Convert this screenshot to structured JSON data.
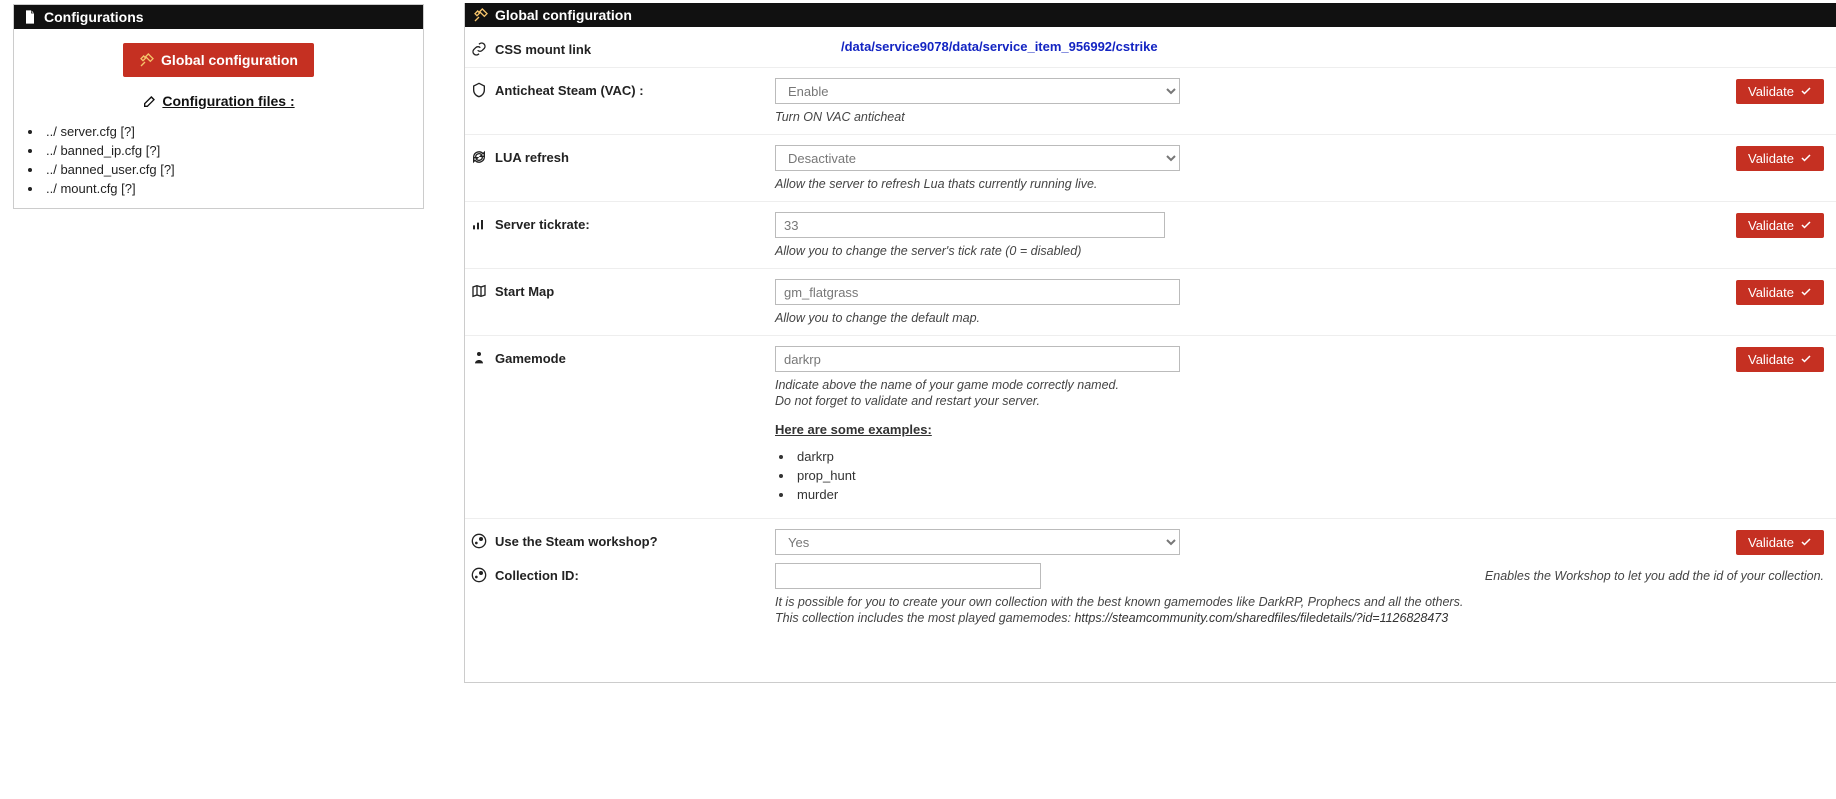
{
  "left": {
    "header": "Configurations",
    "global_btn": "Global configuration",
    "files_label": " Configuration files :",
    "files": [
      {
        "name": "server.cfg",
        "q": "[?]"
      },
      {
        "name": "banned_ip.cfg",
        "q": "[?]"
      },
      {
        "name": "banned_user.cfg",
        "q": "[?]"
      },
      {
        "name": "mount.cfg",
        "q": "[?]"
      }
    ]
  },
  "right": {
    "header": "Global configuration",
    "validate": "Validate",
    "rows": {
      "css_mount": {
        "label": "CSS mount link",
        "path": "/data/service9078/data/service_item_956992/cstrike"
      },
      "vac": {
        "label": "Anticheat Steam (VAC) :",
        "value": "Enable",
        "help": "Turn ON VAC anticheat"
      },
      "lua": {
        "label": "LUA refresh",
        "value": "Desactivate",
        "help": "Allow the server to refresh Lua thats currently running live."
      },
      "tick": {
        "label": "Server tickrate:",
        "value": "33",
        "help": "Allow you to change the server's tick rate (0 = disabled)"
      },
      "startmap": {
        "label": "Start Map",
        "value": "gm_flatgrass",
        "help": "Allow you to change the default map."
      },
      "gamemode": {
        "label": "Gamemode",
        "value": "darkrp",
        "help1": "Indicate above the name of your game mode correctly named.",
        "help2": "Do not forget to validate and restart your server.",
        "examples_head": "Here are some examples:",
        "examples": [
          "darkrp",
          "prop_hunt",
          "murder"
        ]
      },
      "workshop": {
        "label": "Use the Steam workshop?",
        "value": "Yes"
      },
      "collection": {
        "label": "Collection ID:",
        "value": "",
        "note": "Enables the Workshop to let you add the id of your collection.",
        "help1": "It is possible for you to create your own collection with the best known gamemodes like DarkRP, Prophecs and all the others.",
        "help2_pre": "This collection includes the most played gamemodes: ",
        "help2_url": "https://steamcommunity.com/sharedfiles/filedetails/?id=1126828473"
      }
    }
  }
}
